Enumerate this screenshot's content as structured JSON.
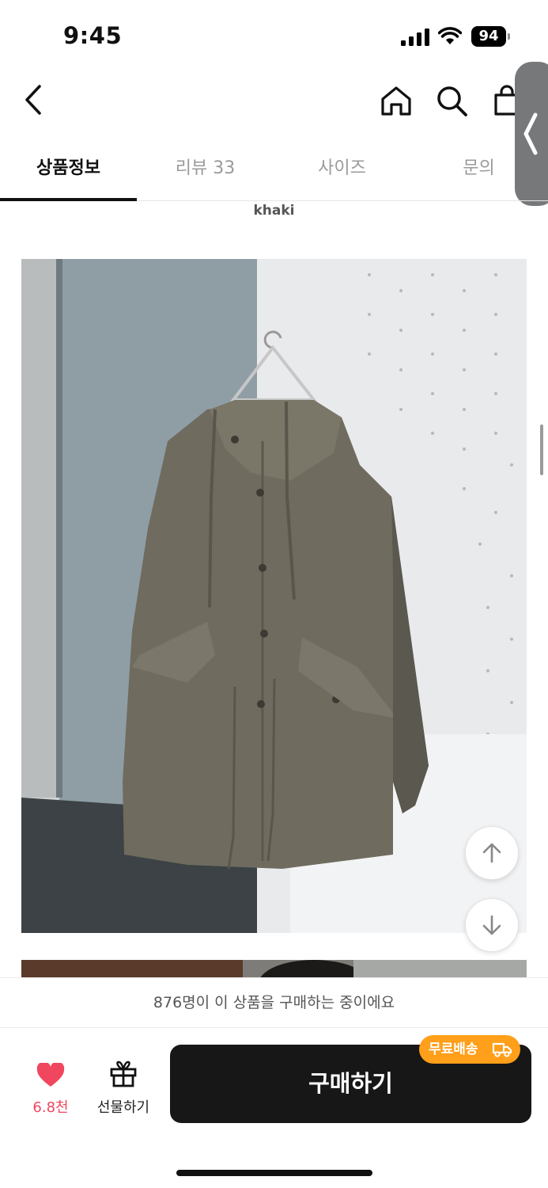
{
  "status_bar": {
    "time": "9:45",
    "battery_level": "94",
    "signal_icon": "cellular-signal-icon",
    "wifi_icon": "wifi-icon"
  },
  "nav": {
    "back_icon": "chevron-left-icon",
    "home_icon": "home-icon",
    "search_icon": "search-icon",
    "cart_icon": "shopping-bag-icon",
    "side_handle_icon": "chevron-left-icon"
  },
  "tabs": [
    {
      "label": "상품정보",
      "active": true
    },
    {
      "label": "리뷰 33",
      "active": false
    },
    {
      "label": "사이즈",
      "active": false
    },
    {
      "label": "문의",
      "active": false
    }
  ],
  "product": {
    "variant_label": "khaki",
    "image_subject": "khaki hooded parka on hanger"
  },
  "floating": {
    "scroll_up_icon": "arrow-up-icon",
    "scroll_down_icon": "arrow-down-icon"
  },
  "bottom": {
    "buyers_notice": "876명이 이 상품을 구매하는 중이에요",
    "like_count": "6.8천",
    "gift_label": "선물하기",
    "buy_label": "구매하기",
    "free_shipping_badge": "무료배송",
    "colors": {
      "heart": "#f0475f",
      "badge": "#ff9f1a",
      "buy_button": "#171717"
    }
  }
}
